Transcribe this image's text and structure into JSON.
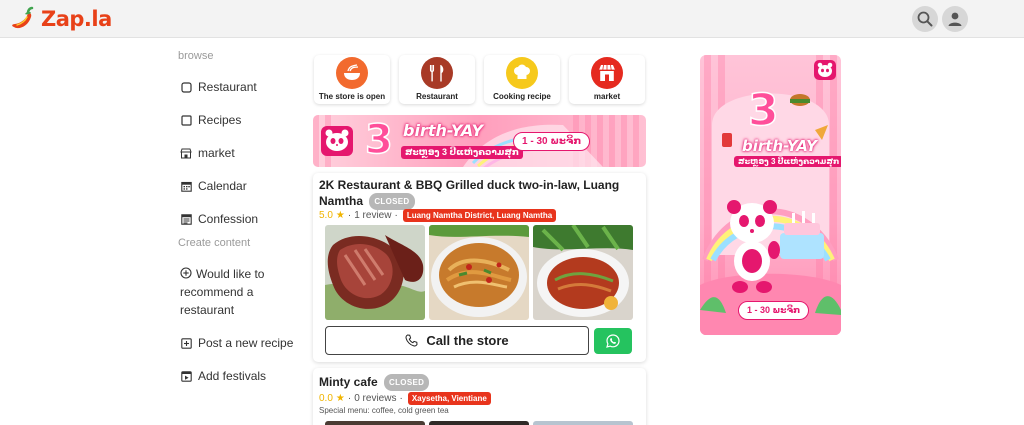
{
  "app": {
    "name": "Zap.la"
  },
  "colors": {
    "brand": "#e84118",
    "closed_badge": "#b7b7b7",
    "location_badge": "#e8341c",
    "whatsapp": "#25c35f",
    "foodpanda_pink": "#e5176e"
  },
  "header": {
    "icons": [
      "search-icon",
      "user-icon"
    ]
  },
  "sidebar": {
    "browse_heading": "browse",
    "browse_items": [
      {
        "label": "Restaurant",
        "icon": "square-icon"
      },
      {
        "label": "Recipes",
        "icon": "square-icon"
      },
      {
        "label": "market",
        "icon": "store-icon"
      },
      {
        "label": "Calendar",
        "icon": "calendar-icon"
      },
      {
        "label": "Confession",
        "icon": "book-icon"
      }
    ],
    "create_heading": "Create content",
    "create_items": [
      {
        "label": "Would like to recommend a restaurant",
        "icon": "plus-circle-icon"
      },
      {
        "label": "Post a new recipe",
        "icon": "plus-square-icon"
      },
      {
        "label": "Add festivals",
        "icon": "play-square-icon"
      }
    ]
  },
  "categories": [
    {
      "label": "The store is open",
      "icon": "bowl-icon",
      "color": "#f26a2e"
    },
    {
      "label": "Restaurant",
      "icon": "fork-knife-icon",
      "color": "#a83a26"
    },
    {
      "label": "Cooking recipe",
      "icon": "chef-hat-icon",
      "color": "#f6c91c"
    },
    {
      "label": "market",
      "icon": "store-icon",
      "color": "#e52a1f"
    }
  ],
  "banner": {
    "brand_text": "birth-YAY",
    "number": "3",
    "sub_text": "ສະຫຼອງ 3 ປີແຫ່ງຄວາມສຸກ",
    "date_text": "1 - 30 ພະຈິກ"
  },
  "listings": [
    {
      "title": "2K Restaurant & BBQ Grilled duck two-in-law, Luang Namtha",
      "status": "CLOSED",
      "rating": "5.0",
      "reviews": "1 review",
      "location": "Luang Namtha District, Luang Namtha",
      "call_label": "Call the store"
    },
    {
      "title": "Minty cafe",
      "status": "CLOSED",
      "rating": "0.0",
      "reviews": "0 reviews",
      "location": "Xaysetha, Vientiane",
      "special": "Special menu: coffee, cold green tea"
    }
  ],
  "ad": {
    "brand_text": "birth-YAY",
    "number": "3",
    "sub_text": "ສະຫຼອງ 3 ປີແຫ່ງຄວາມສຸກ",
    "date_text": "1 - 30 ພະຈິກ"
  }
}
